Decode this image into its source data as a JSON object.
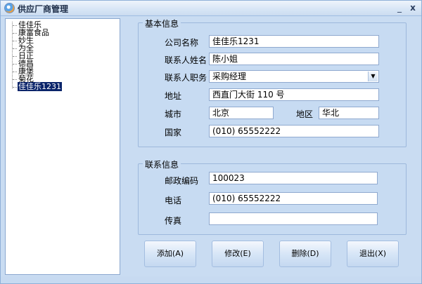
{
  "window": {
    "title": "供应厂商管理",
    "min_glyph": "_",
    "close_glyph": "x"
  },
  "tree": {
    "items": [
      "佳佳乐",
      "康富食品",
      "妙生",
      "为全",
      "日正",
      "德昌",
      "康堡",
      "菊花",
      "佳佳乐1231"
    ],
    "selected_index": 8
  },
  "basic": {
    "title": "基本信息",
    "company_label": "公司名称",
    "company_value": "佳佳乐1231",
    "contact_label": "联系人姓名",
    "contact_value": "陈小姐",
    "position_label": "联系人职务",
    "position_value": "采购经理",
    "address_label": "地址",
    "address_value": "西直门大街 110 号",
    "city_label": "城市",
    "city_value": "北京",
    "region_label": "地区",
    "region_value": "华北",
    "country_label": "国家",
    "country_value": "(010) 65552222"
  },
  "contact": {
    "title": "联系信息",
    "postal_label": "邮政编码",
    "postal_value": "100023",
    "phone_label": "电话",
    "phone_value": "(010) 65552222",
    "fax_label": "传真",
    "fax_value": ""
  },
  "buttons": {
    "add": "添加(A)",
    "edit": "修改(E)",
    "delete": "删除(D)",
    "exit": "退出(X)"
  }
}
